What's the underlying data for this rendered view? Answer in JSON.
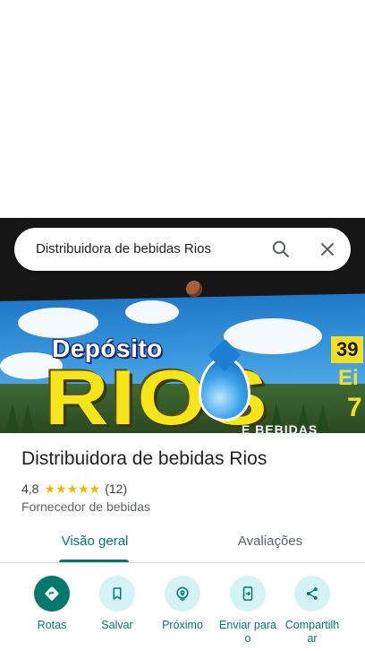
{
  "search": {
    "query": "Distribuidora de bebidas Rios"
  },
  "photo": {
    "sign_top_word": "Depósito",
    "sign_main_word": "RIOS",
    "sign_price": "39",
    "sign_sub": "Ei",
    "sign_num": "7",
    "sign_strip": "E BEBIDAS"
  },
  "place": {
    "name": "Distribuidora de bebidas Rios",
    "rating": "4,8",
    "stars": "★★★★★",
    "review_count": "(12)",
    "category": "Fornecedor de bebidas"
  },
  "tabs": [
    {
      "label": "Visão geral",
      "selected": true
    },
    {
      "label": "Avaliações",
      "selected": false
    }
  ],
  "actions": [
    {
      "label": "Rotas",
      "icon": "directions-icon"
    },
    {
      "label": "Salvar",
      "icon": "bookmark-icon"
    },
    {
      "label": "Próximo",
      "icon": "nearby-icon"
    },
    {
      "label": "Enviar para o",
      "icon": "send-to-phone-icon"
    },
    {
      "label": "Compartilhar",
      "icon": "share-icon"
    }
  ],
  "colors": {
    "accent": "#00796b",
    "action_bg": "#d5f2f5",
    "star": "#f5b400"
  }
}
